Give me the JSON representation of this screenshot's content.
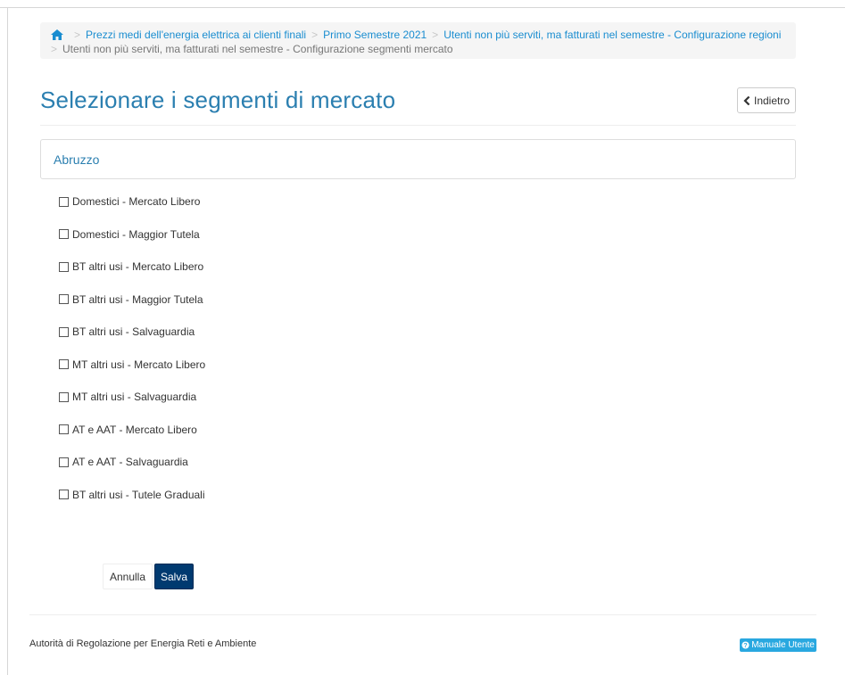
{
  "breadcrumb": {
    "items": [
      "Prezzi medi dell'energia elettrica ai clienti finali",
      "Primo Semestre 2021",
      "Utenti non più serviti, ma fatturati nel semestre - Configurazione regioni"
    ],
    "current": "Utenti non più serviti, ma fatturati nel semestre - Configurazione segmenti mercato",
    "separator": ">"
  },
  "page": {
    "title": "Selezionare i segmenti di mercato",
    "back_label": "Indietro"
  },
  "panel": {
    "heading": "Abruzzo"
  },
  "options": [
    {
      "label": "Domestici - Mercato Libero",
      "checked": false
    },
    {
      "label": "Domestici - Maggior Tutela",
      "checked": false
    },
    {
      "label": "BT altri usi - Mercato Libero",
      "checked": false
    },
    {
      "label": "BT altri usi - Maggior Tutela",
      "checked": false
    },
    {
      "label": "BT altri usi - Salvaguardia",
      "checked": false
    },
    {
      "label": "MT altri usi - Mercato Libero",
      "checked": false
    },
    {
      "label": "MT altri usi - Salvaguardia",
      "checked": false
    },
    {
      "label": "AT e AAT - Mercato Libero",
      "checked": false
    },
    {
      "label": "AT e AAT - Salvaguardia",
      "checked": false
    },
    {
      "label": "BT altri usi - Tutele Graduali",
      "checked": false
    }
  ],
  "actions": {
    "cancel_label": "Annulla",
    "save_label": "Salva"
  },
  "footer": {
    "organization": "Autorità di Regolazione per Energia Reti e Ambiente",
    "manual_label": "Manuale Utente"
  },
  "colors": {
    "accent": "#2b7fb0",
    "link": "#1a8dd0",
    "primary_button": "#003a70",
    "badge": "#29a8e0"
  }
}
